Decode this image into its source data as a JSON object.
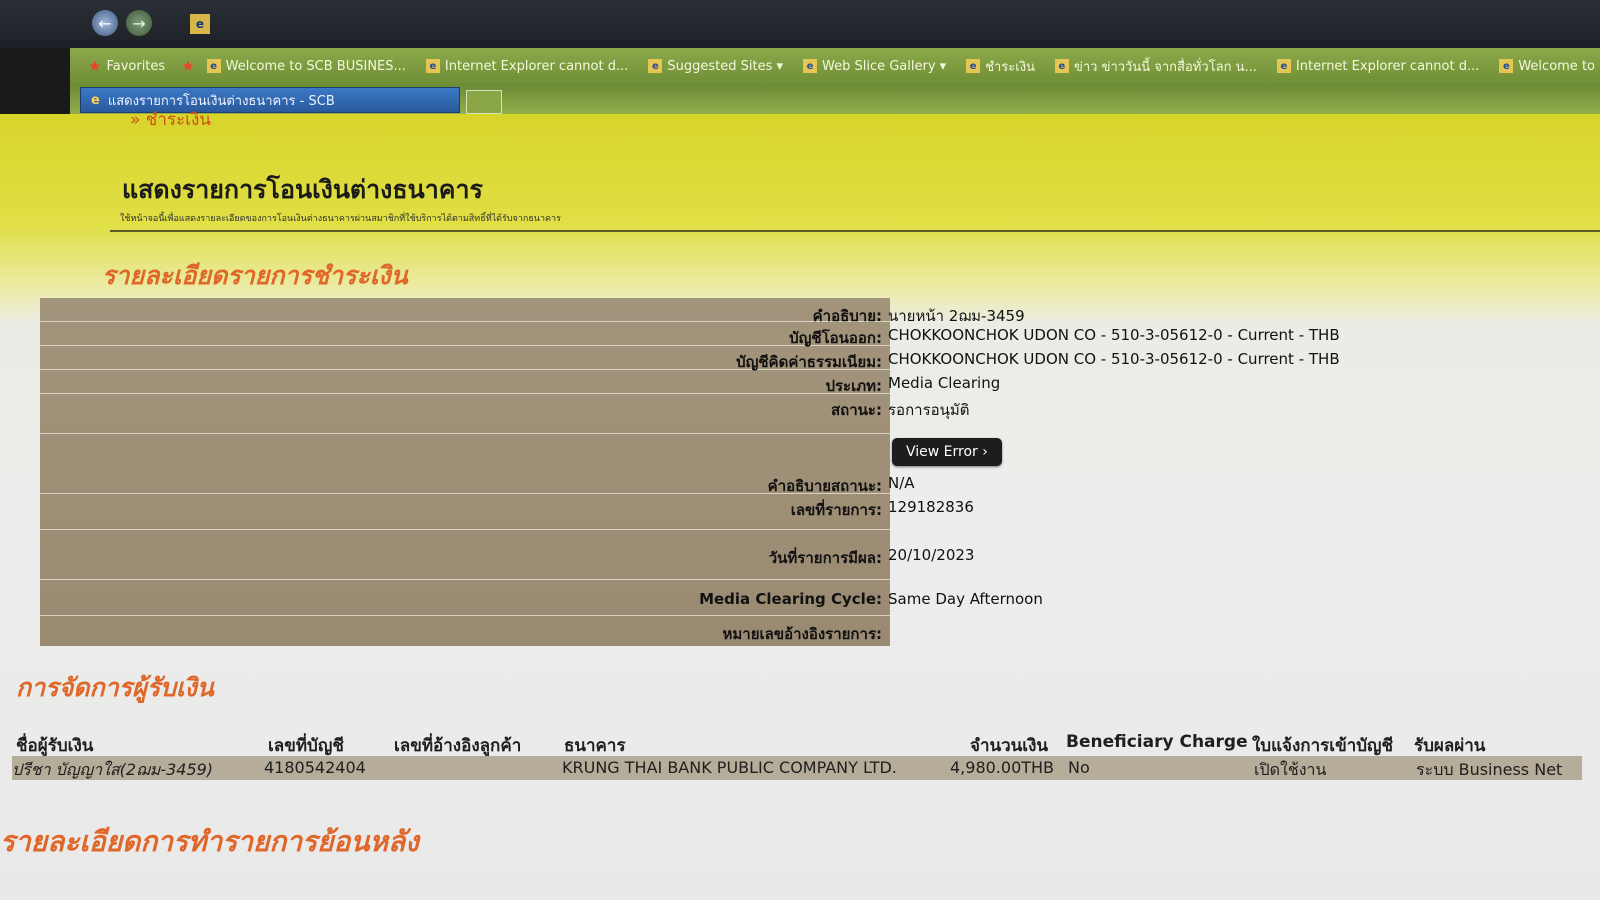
{
  "browser": {
    "favorites_label": "Favorites",
    "favorites_items": [
      "Welcome to SCB BUSINES...",
      "Internet Explorer cannot d...",
      "Suggested Sites ▾",
      "Web Slice Gallery ▾",
      "ชำระเงิน",
      "ข่าว ข่าววันนี้ จากสื่อทั่วโลก น...",
      "Internet Explorer cannot d...",
      "Welcome to SCB"
    ],
    "active_tab_title": "แสดงรายการโอนเงินต่างธนาคาร - SCB"
  },
  "page": {
    "breadcrumb": "» ชำระเงิน",
    "title": "แสดงรายการโอนเงินต่างธนาคาร",
    "subtitle": "ใช้หน้าจอนี้เพื่อแสดงรายละเอียดของการโอนเงินต่างธนาคารผ่านสมาชิกที่ใช้บริการได้ตามสิทธิ์ที่ได้รับจากธนาคาร",
    "payment_details_heading": "รายละเอียดรายการชำระเงิน",
    "payee_heading": "การจัดการผู้รับเงิน",
    "backdated_heading": "รายละเอียดการทำรายการย้อนหลัง"
  },
  "details": [
    {
      "label": "คำอธิบาย:",
      "value": "นายหน้า 2ฌม-3459"
    },
    {
      "label": "บัญชีโอนออก:",
      "value": "CHOKKOONCHOK UDON CO - 510-3-05612-0 - Current - THB"
    },
    {
      "label": "บัญชีคิดค่าธรรมเนียม:",
      "value": "CHOKKOONCHOK UDON CO - 510-3-05612-0 - Current - THB"
    },
    {
      "label": "ประเภท:",
      "value": "Media Clearing"
    },
    {
      "label": "สถานะ:",
      "value": "รอการอนุมัติ"
    },
    {
      "label": "คำอธิบายสถานะ:",
      "value": "N/A"
    },
    {
      "label": "เลขที่รายการ:",
      "value": "129182836"
    },
    {
      "label": "วันที่รายการมีผล:",
      "value": "20/10/2023"
    },
    {
      "label": "Media Clearing Cycle:",
      "value": "Same Day Afternoon"
    },
    {
      "label": "หมายเลขอ้างอิงรายการ:",
      "value": ""
    }
  ],
  "view_error_label": "View Error ›",
  "payee_table": {
    "headers": [
      "ชื่อผู้รับเงิน",
      "เลขที่บัญชี",
      "เลขที่อ้างอิงลูกค้า",
      "ธนาคาร",
      "จำนวนเงิน",
      "Beneficiary Charge",
      "ใบแจ้งการเข้าบัญชี",
      "รับผลผ่าน"
    ],
    "rows": [
      [
        "ปรีชา บัญญาใส(2ฌม-3459)",
        "4180542404",
        "",
        "KRUNG THAI BANK PUBLIC COMPANY LTD.",
        "4,980.00THB",
        "No",
        "เปิดใช้งาน",
        "ระบบ Business Net"
      ]
    ]
  }
}
